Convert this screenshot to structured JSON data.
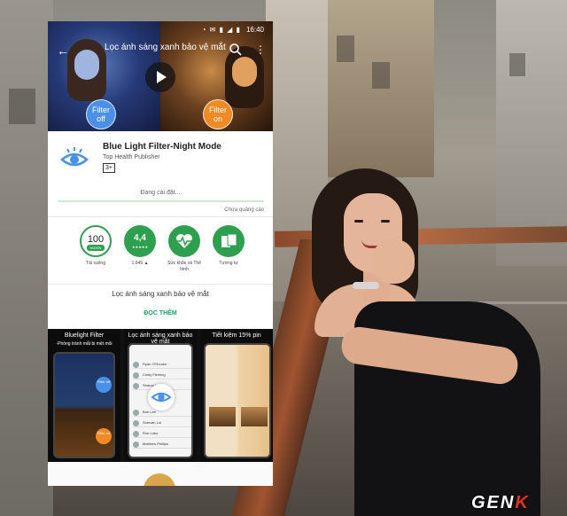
{
  "status_bar": {
    "time": "16:40",
    "icons": "◔ ✉ ▮ ◢ ▮"
  },
  "hero": {
    "title": "Lọc ánh sáng xanh bảo vệ mắt",
    "filter_off": "Filter off",
    "filter_on": "Filter on"
  },
  "app": {
    "name": "Blue Light Filter-Night Mode",
    "publisher": "Top Health Publisher",
    "content_rating": "3+",
    "install_status": "Đang cài đặt...",
    "install_progress": 0,
    "ads_note": "Chứa quảng cáo"
  },
  "stats": {
    "downloads": {
      "value": "100",
      "unit": "NGHÌN",
      "label": "Tải xuống"
    },
    "rating": {
      "value": "4,4",
      "stars": "★★★★★",
      "label": "1.649 ▲"
    },
    "category": {
      "label": "Sức khỏe và Thể hình",
      "icon": "heart-pulse-icon"
    },
    "similar": {
      "label": "Tương tự",
      "icon": "cards-icon"
    }
  },
  "description": "Lọc ánh sáng xanh bảo vệ mắt",
  "read_more": "ĐỌC THÊM",
  "screenshots": [
    {
      "caption": "Bluelight Filter",
      "subcaption": "-Phòng tránh mắt bị mệt mỏi",
      "filter_off": "Filter off",
      "filter_on": "Filter on"
    },
    {
      "caption": "Lọc ánh sáng xanh bảo vệ mắt",
      "list": [
        "Ryan O'Rourke",
        "Cindy Fleming",
        "Sharon Lam",
        "Bob Lee",
        "Sherwin Lui",
        "Rob Lobo",
        "Matthew Phillips"
      ]
    },
    {
      "caption": "Tiết kiệm 15% pin"
    }
  ],
  "watermark": {
    "text": "GEN",
    "accent": "K"
  },
  "colors": {
    "accent": "#2e9e4f",
    "filter_off": "#4a90e8",
    "filter_on": "#f08a24"
  }
}
